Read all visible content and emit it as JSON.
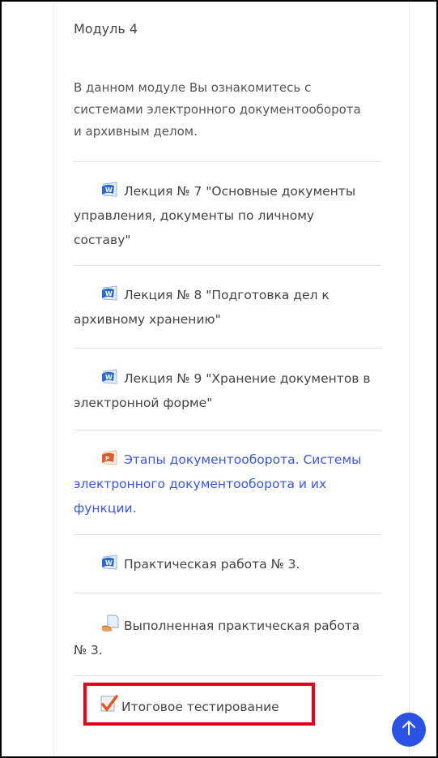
{
  "module": {
    "title": "Модуль 4",
    "summary": "В данном модуле Вы ознакомитесь с системами электронного документооборота и архивным делом."
  },
  "activities": [
    {
      "label": "Лекция № 7 \"Основные документы управления, документы по личному составу\"",
      "icon": "word-doc-icon",
      "link": false
    },
    {
      "label": "Лекция № 8 \"Подготовка дел к архивному хранению\"",
      "icon": "word-doc-icon",
      "link": false
    },
    {
      "label": "Лекция № 9 \"Хранение документов в электронной форме\"",
      "icon": "word-doc-icon",
      "link": false
    },
    {
      "label": "Этапы документооборота. Системы электронного документооборота и их функции.",
      "icon": "powerpoint-doc-icon",
      "link": true
    },
    {
      "label": "Практическая работа № 3.",
      "icon": "word-doc-icon",
      "link": false
    },
    {
      "label": "Выполненная практическая работа № 3.",
      "icon": "assignment-icon",
      "link": false
    },
    {
      "label": "Итоговое тестирование",
      "icon": "quiz-icon",
      "link": false
    }
  ],
  "colors": {
    "link": "#3b57d6",
    "highlight_border": "#e4001c",
    "scroll_button": "#2b53e3"
  },
  "scroll_top": {
    "icon": "arrow-up-icon"
  }
}
